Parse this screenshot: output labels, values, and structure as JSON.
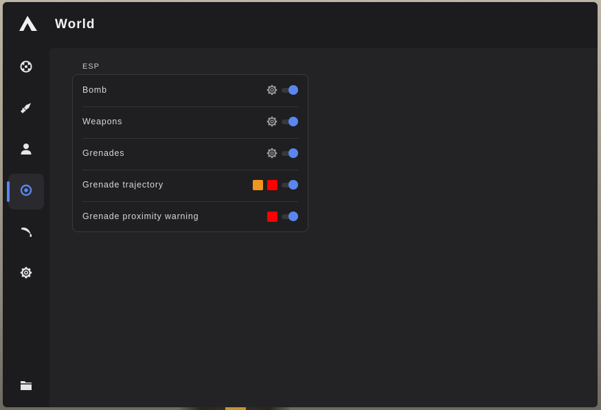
{
  "app": {
    "title": "World",
    "accent_color": "#5b86f0"
  },
  "sidebar": {
    "items": [
      {
        "icon": "crosshair-icon",
        "active": false
      },
      {
        "icon": "sword-icon",
        "active": false
      },
      {
        "icon": "person-icon",
        "active": false
      },
      {
        "icon": "eye-icon",
        "active": true
      },
      {
        "icon": "knife-icon",
        "active": false
      },
      {
        "icon": "gear-icon",
        "active": false
      },
      {
        "icon": "folder-icon",
        "active": false
      }
    ]
  },
  "esp": {
    "section_label": "ESP",
    "rows": [
      {
        "label": "Bomb",
        "controls": [
          "gear-icon"
        ],
        "enabled": true
      },
      {
        "label": "Weapons",
        "controls": [
          "gear-icon"
        ],
        "enabled": true
      },
      {
        "label": "Grenades",
        "controls": [
          "gear-icon"
        ],
        "enabled": true
      },
      {
        "label": "Grenade trajectory",
        "colors": [
          "#f0961e",
          "#ff0000"
        ],
        "enabled": true
      },
      {
        "label": "Grenade proximity warning",
        "colors": [
          "#ff0000"
        ],
        "enabled": true
      }
    ]
  }
}
